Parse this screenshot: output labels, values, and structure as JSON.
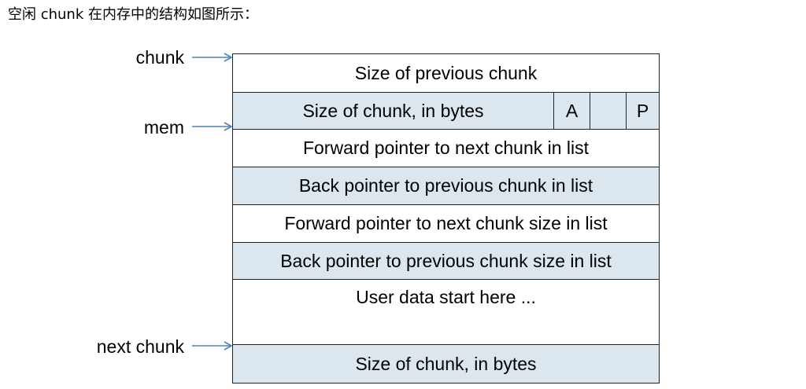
{
  "caption": "空闲 chunk 在内存中的结构如图所示：",
  "pointers": {
    "chunk": "chunk",
    "mem": "mem",
    "next_chunk": "next chunk"
  },
  "rows": {
    "size_prev": "Size of previous chunk",
    "size_chunk": "Size of chunk, in bytes",
    "flag_a": "A",
    "flag_m": "",
    "flag_p": "P",
    "fd": "Forward pointer to next chunk in list",
    "bk": "Back pointer to previous chunk in list",
    "fd_nextsize": "Forward pointer to next chunk size in list",
    "bk_nextsize": "Back pointer to previous chunk size in list",
    "user_data": "User data start here ...",
    "next_size": "Size of chunk, in bytes"
  },
  "colors": {
    "shade": "#dce6ee",
    "arrow": "#4f81bd",
    "border": "#222222"
  }
}
